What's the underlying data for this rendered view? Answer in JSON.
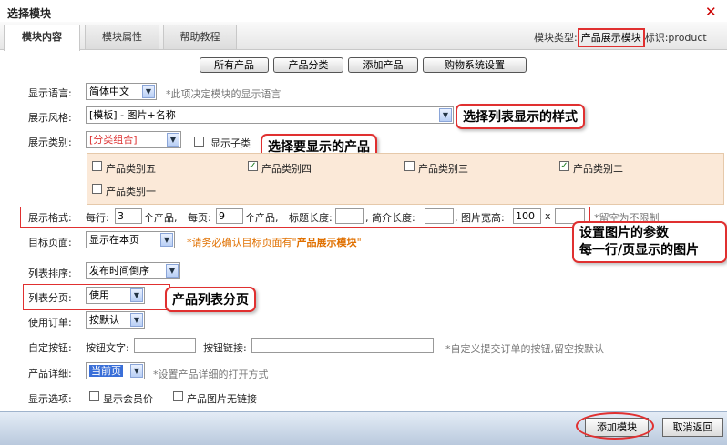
{
  "window": {
    "title": "选择模块",
    "close": "✕"
  },
  "tabs": [
    {
      "label": "模块内容"
    },
    {
      "label": "模块属性"
    },
    {
      "label": "帮助教程"
    }
  ],
  "module_info": {
    "type_label": "模块类型:",
    "type_value": "产品展示模块",
    "id_label": "标识:product"
  },
  "top_buttons": [
    "所有产品",
    "产品分类",
    "添加产品",
    "购物系统设置"
  ],
  "language": {
    "label": "显示语言:",
    "value": "简体中文",
    "hint": "*此项决定模块的显示语言"
  },
  "style": {
    "label": "展示风格:",
    "value": "[模板] - 图片+名称"
  },
  "category": {
    "label": "展示类别:",
    "value": "[分类组合]",
    "show_sub_label": "显示子类",
    "show_sub_checked": false
  },
  "categories": [
    {
      "label": "产品类别五",
      "checked": false
    },
    {
      "label": "产品类别四",
      "checked": true
    },
    {
      "label": "产品类别三",
      "checked": false
    },
    {
      "label": "产品类别二",
      "checked": true
    },
    {
      "label": "产品类别一",
      "checked": false
    }
  ],
  "format": {
    "label": "展示格式:",
    "per_row_label": "每行:",
    "per_row": "3",
    "per_row_unit": "个产品,",
    "per_page_label": "每页:",
    "per_page": "9",
    "per_page_unit": "个产品,",
    "title_len_label": "标题长度:",
    "title_len": "",
    "summary_len_label": ",  简介长度:",
    "summary_len": "",
    "img_label": ",  图片宽高:",
    "img_w": "100",
    "img_x": "x",
    "img_h": "",
    "hint": "*留空为不限制"
  },
  "target": {
    "label": "目标页面:",
    "value": "显示在本页",
    "hint_pre": "*请务必确认目标页面有\"",
    "hint_bold": "产品展示模块",
    "hint_post": "\""
  },
  "sort": {
    "label": "列表排序:",
    "value": "发布时间倒序"
  },
  "paging": {
    "label": "列表分页:",
    "value": "使用"
  },
  "order": {
    "label": "使用订单:",
    "value": "按默认"
  },
  "custom_button": {
    "label": "自定按钮:",
    "text_label": "按钮文字:",
    "text_value": "",
    "link_label": "按钮链接:",
    "link_value": "",
    "hint": "*自定义提交订单的按钮,留空按默认"
  },
  "detail": {
    "label": "产品详细:",
    "value": "当前页",
    "hint": "*设置产品详细的打开方式"
  },
  "display_options": {
    "label": "显示选项:",
    "member_price": "显示会员价",
    "no_link": "产品图片无链接"
  },
  "annotations": {
    "style": "选择列表显示的样式",
    "products": "选择要显示的产品",
    "image_params_1": "设置图片的参数",
    "image_params_2": "每一行/页显示的图片",
    "paging": "产品列表分页"
  },
  "footer": {
    "add": "添加模块",
    "cancel": "取消返回"
  },
  "colors": {
    "accent_red": "#e03030",
    "category_bg": "#fbe9d8",
    "selected_blue": "#3a6fd8"
  }
}
